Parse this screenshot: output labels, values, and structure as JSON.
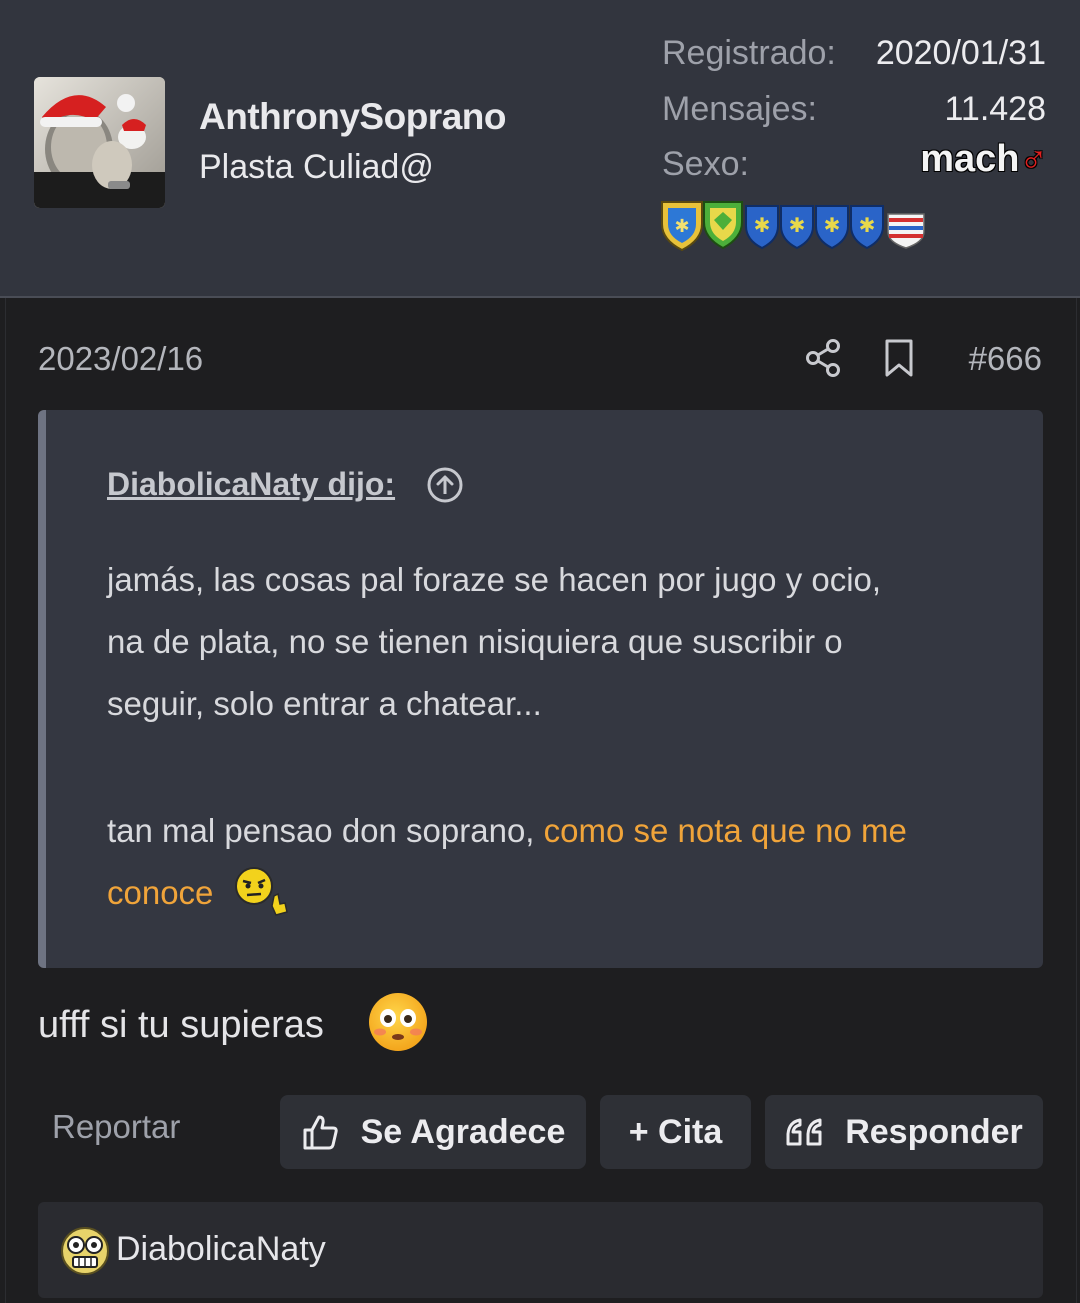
{
  "user": {
    "username": "AnthronySoprano",
    "title": "Plasta Culiad@",
    "avatar": "avatar-photo",
    "stats": {
      "registered_label": "Registrado:",
      "registered_value": "2020/01/31",
      "messages_label": "Mensajes:",
      "messages_value": "11.428",
      "gender_label": "Sexo:",
      "gender_text": "mach",
      "gender_symbol": "♂"
    },
    "trophy_icons": [
      "gold-shield-icon",
      "green-shield-icon",
      "blue-shield-icon",
      "blue-shield-icon",
      "blue-shield-icon",
      "blue-shield-icon",
      "striped-shield-icon"
    ]
  },
  "post": {
    "date": "2023/02/16",
    "number": "#666",
    "quote": {
      "author": "DiabolicaNaty dijo:",
      "line1": "jamás, las cosas pal foraze se hacen por jugo y ocio,",
      "line2": "na de plata, no se tienen nisiquiera que suscribir o",
      "line3": "seguir, solo entrar a chatear...",
      "line4_plain": "tan mal pensao don soprano, ",
      "line4_highlight": "como se nota que no me",
      "line5_highlight": "conoce"
    },
    "body": "ufff si tu supieras",
    "actions": {
      "report": "Reportar",
      "like": "Se Agradece",
      "quote": "+ Cita",
      "reply": "Responder"
    },
    "reactions": {
      "user": "DiabolicaNaty"
    }
  },
  "colors": {
    "header_bg": "#32353e",
    "page_bg": "#1e1e20",
    "quote_bg": "#343741",
    "highlight": "#f0a43a",
    "button_bg": "#2e3036"
  }
}
